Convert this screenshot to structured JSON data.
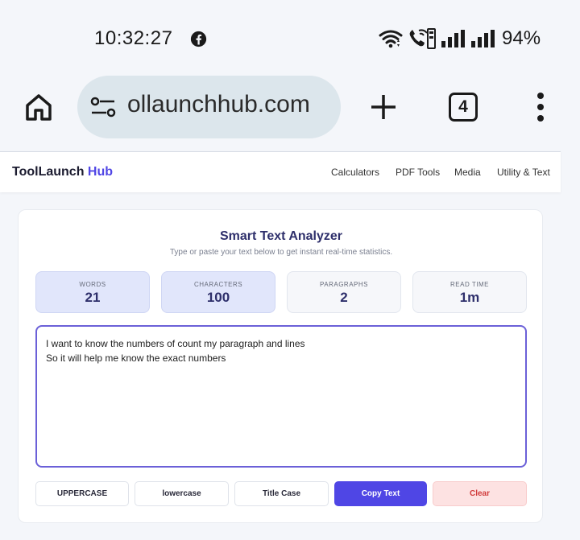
{
  "status_bar": {
    "time": "10:32:27",
    "battery": "94%",
    "icons": [
      "facebook-icon",
      "wifi-icon",
      "wifi-call-icon",
      "signal-icon",
      "signal-icon"
    ]
  },
  "browser": {
    "url": "ollaunchhub.com",
    "tab_count": "4",
    "icons": [
      "home-icon",
      "site-settings-icon",
      "new-tab-icon",
      "overflow-menu-icon"
    ]
  },
  "site": {
    "logo_main": "ToolLaunch",
    "logo_accent": "Hub",
    "nav": [
      "Calculators",
      "PDF Tools",
      "Media",
      "Utility & Text"
    ]
  },
  "analyzer": {
    "title": "Smart Text Analyzer",
    "subtitle": "Type or paste your text below to get instant real-time statistics.",
    "stats": [
      {
        "label": "WORDS",
        "value": "21"
      },
      {
        "label": "CHARACTERS",
        "value": "100"
      },
      {
        "label": "PARAGRAPHS",
        "value": "2"
      },
      {
        "label": "READ TIME",
        "value": "1m"
      }
    ],
    "text": "I want to know the numbers of count my paragraph and lines\nSo it will help me know the exact numbers",
    "buttons": [
      "UPPERCASE",
      "lowercase",
      "Title Case",
      "Copy Text",
      "Clear"
    ]
  },
  "colors": {
    "accent": "#4f46e5",
    "title": "#2e2f6b",
    "stat_active_bg": "#e1e6fb",
    "clear_bg": "#fde2e2",
    "clear_text": "#d13b3b",
    "url_pill": "#dce6ec"
  }
}
